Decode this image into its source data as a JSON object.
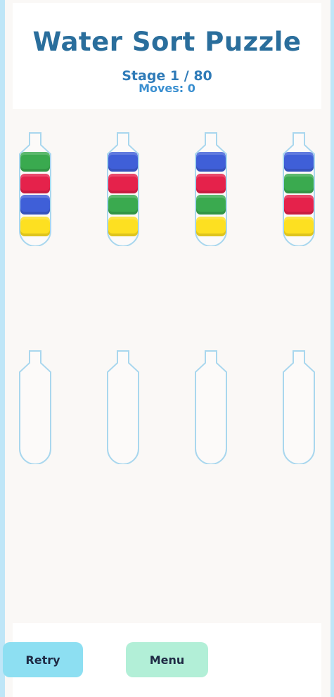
{
  "header": {
    "title": "Water Sort Puzzle",
    "stage": "Stage 1 / 80",
    "moves": "Moves: 0"
  },
  "colors": {
    "green": "#3aaa4f",
    "red": "#e5224b",
    "blue": "#3f5fd8",
    "yellow": "#fde021",
    "tube_outline": "#a9d7ee",
    "title": "#2a6e9c"
  },
  "tubes": [
    {
      "layers_top_to_bottom": [
        "green",
        "red",
        "blue",
        "yellow"
      ]
    },
    {
      "layers_top_to_bottom": [
        "blue",
        "red",
        "green",
        "yellow"
      ]
    },
    {
      "layers_top_to_bottom": [
        "blue",
        "red",
        "green",
        "yellow"
      ]
    },
    {
      "layers_top_to_bottom": [
        "blue",
        "green",
        "red",
        "yellow"
      ]
    },
    {
      "layers_top_to_bottom": []
    },
    {
      "layers_top_to_bottom": []
    },
    {
      "layers_top_to_bottom": []
    },
    {
      "layers_top_to_bottom": []
    }
  ],
  "buttons": {
    "retry": "Retry",
    "menu": "Menu"
  }
}
